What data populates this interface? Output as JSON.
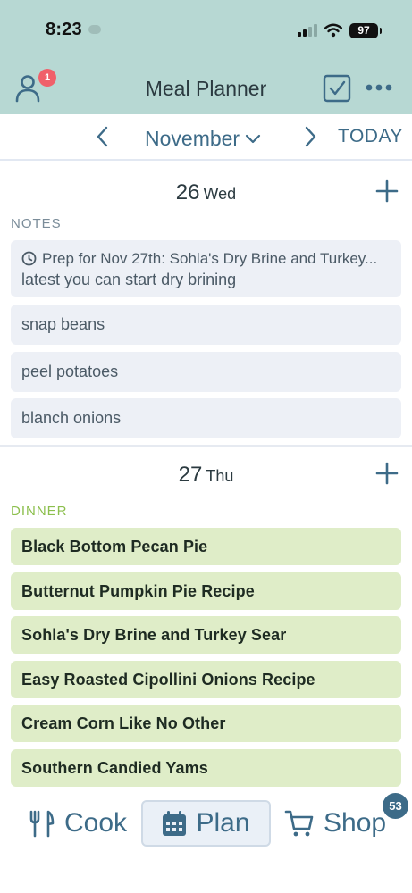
{
  "status": {
    "time": "8:23",
    "battery": "97"
  },
  "nav": {
    "title": "Meal Planner",
    "profile_badge": "1"
  },
  "monthbar": {
    "month": "November",
    "today_label": "TODAY"
  },
  "days": [
    {
      "num": "26",
      "weekday": "Wed",
      "section_label": "NOTES",
      "first_note_line1": "Prep for Nov 27th: Sohla's Dry Brine and Turkey...",
      "first_note_line2": "latest you can start dry brining",
      "notes": [
        "snap beans",
        "peel potatoes",
        "blanch onions"
      ]
    },
    {
      "num": "27",
      "weekday": "Thu",
      "section_label": "DINNER",
      "meals": [
        "Black Bottom Pecan Pie",
        "Butternut Pumpkin Pie Recipe",
        "Sohla's Dry Brine and Turkey Sear",
        "Easy Roasted Cipollini Onions Recipe",
        "Cream Corn Like No Other",
        "Southern Candied Yams"
      ]
    }
  ],
  "tabs": {
    "cook": "Cook",
    "plan": "Plan",
    "shop": "Shop",
    "shop_badge": "53"
  },
  "colors": {
    "header": "#b7d8d3",
    "accent": "#3d6b88",
    "meal_card": "#dfedc8",
    "note_card": "#edf0f6",
    "dinner_label": "#8cbf4d",
    "badge_red": "#f0606a"
  },
  "icons": [
    "profile-icon",
    "checkbox-icon",
    "more-icon",
    "chevron-left-icon",
    "chevron-down-icon",
    "chevron-right-icon",
    "plus-icon",
    "clock-icon",
    "fork-knife-icon",
    "calendar-icon",
    "cart-icon"
  ]
}
